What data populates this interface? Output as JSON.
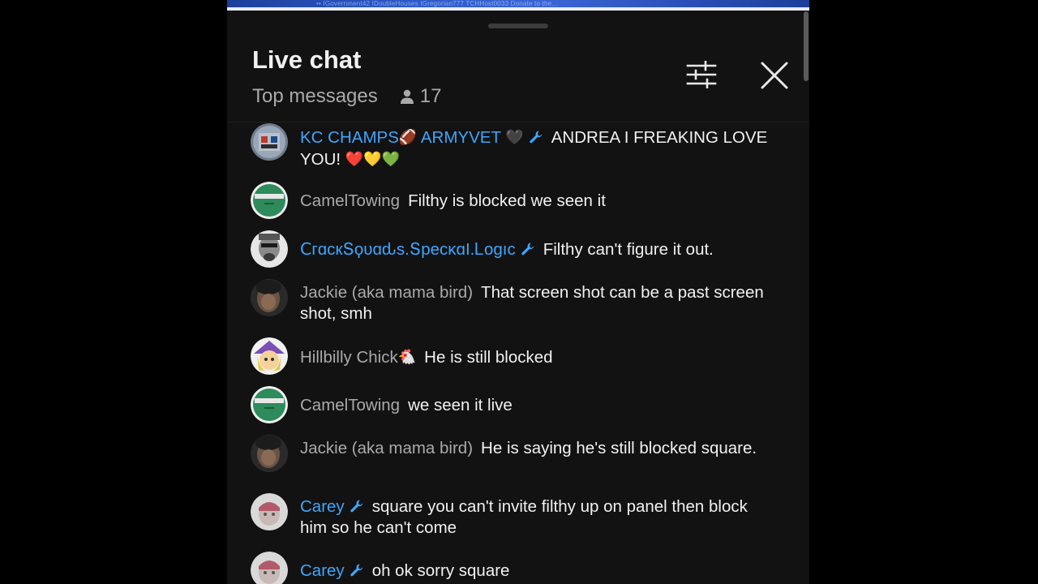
{
  "top_strip": {
    "text": "•• IGovernment42 IDoubleHouses IGregorian777 TCHHost0033 Donate to the..."
  },
  "header": {
    "title": "Live chat",
    "subtitle": "Top messages",
    "viewer_count": "17",
    "icons": {
      "viewers": "person-icon",
      "filter": "sliders-icon",
      "close": "close-icon"
    }
  },
  "colors": {
    "background": "#121212",
    "text_primary": "#f1f1f1",
    "text_secondary": "#aaaaaa",
    "moderator_name": "#3ea6ff",
    "camel_avatar": "#2e8b5b"
  },
  "messages": [
    {
      "author_parts": [
        "KC CHAMPS",
        "🏈",
        " ARMYVET ",
        "🖤"
      ],
      "moderator": true,
      "text": "ANDREA I FREAKING LOVE YOU!",
      "emojis": "❤️💛💚",
      "avatar": "photo"
    },
    {
      "author": "CamelTowing",
      "moderator": false,
      "text": "Filthy is blocked we seen it",
      "avatar": "green"
    },
    {
      "author": "ꓚгɑскՏϙυɑԃѕ.ՏресĸɑІ.Ꮮοɡıс",
      "moderator": true,
      "text": "Filthy can't figure it out.",
      "avatar": "face"
    },
    {
      "author": "Jackie (aka mama bird)",
      "moderator": false,
      "text": "That screen shot can be a past screen shot, smh",
      "avatar": "dark"
    },
    {
      "author": "Hillbilly Chick",
      "author_emoji": "🐔",
      "moderator": false,
      "text": "He is still blocked",
      "avatar": "cartoon"
    },
    {
      "author": "CamelTowing",
      "moderator": false,
      "text": "we seen it live",
      "avatar": "green"
    },
    {
      "author": "Jackie (aka mama bird)",
      "moderator": false,
      "text": "He is saying he's still blocked square.",
      "avatar": "dark"
    },
    {
      "author": "Carey",
      "moderator": true,
      "text": "square you can't invite filthy up on panel then block him so he can't come",
      "avatar": "pale"
    },
    {
      "author": "Carey",
      "moderator": true,
      "text": "oh ok sorry square",
      "avatar": "pale"
    }
  ]
}
